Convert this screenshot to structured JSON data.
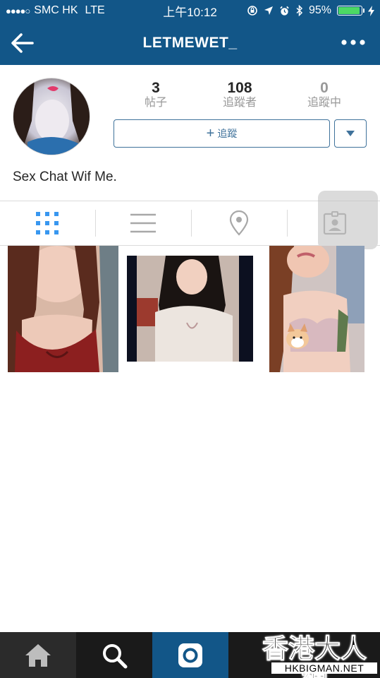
{
  "status_bar": {
    "signal": "●●●●○",
    "carrier": "SMC HK",
    "network": "LTE",
    "time": "上午10:12",
    "battery": "95%",
    "battery_level": 0.95
  },
  "nav": {
    "title": "LETMEWET_"
  },
  "profile": {
    "stats": [
      {
        "value": "3",
        "label": "帖子"
      },
      {
        "value": "108",
        "label": "追蹤者"
      },
      {
        "value": "0",
        "label": "追蹤中"
      }
    ],
    "follow_label": "追蹤",
    "bio": "Sex Chat Wif Me."
  },
  "tabs": [
    "grid-icon",
    "list-icon",
    "location-pin-icon",
    "tagged-person-icon"
  ],
  "bottom_tabs": [
    "home-icon",
    "search-icon",
    "camera-icon"
  ],
  "watermark": {
    "title": "香港大人網",
    "url": "HKBIGMAN.NET"
  },
  "colors": {
    "header": "#125688",
    "button_blue": "#3f729b",
    "active_tab": "#3897f0"
  }
}
